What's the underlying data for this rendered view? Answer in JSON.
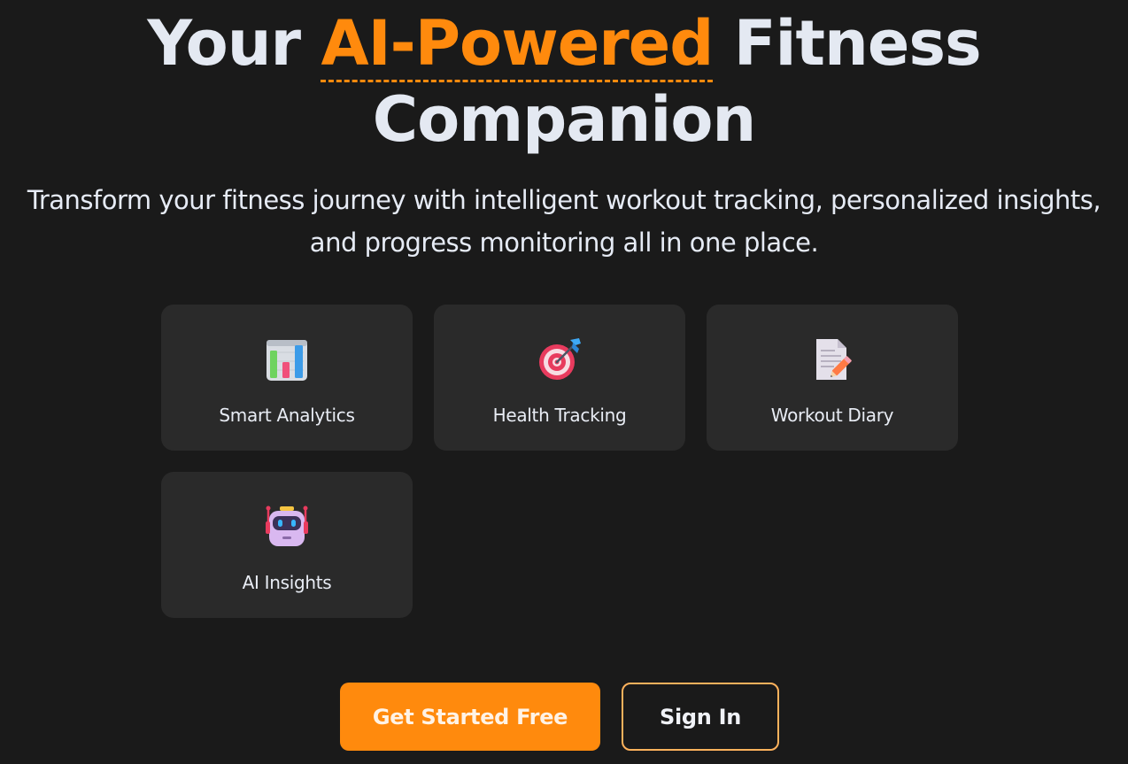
{
  "hero": {
    "title_prefix": "Your ",
    "title_accent": "AI-Powered",
    "title_suffix": " Fitness Companion",
    "subtitle": "Transform your fitness journey with intelligent workout tracking, personalized insights, and progress monitoring all in one place."
  },
  "features": [
    {
      "label": "Smart Analytics",
      "icon": "bar-chart-icon"
    },
    {
      "label": "Health Tracking",
      "icon": "target-icon"
    },
    {
      "label": "Workout Diary",
      "icon": "notepad-icon"
    },
    {
      "label": "AI Insights",
      "icon": "robot-icon"
    }
  ],
  "actions": {
    "primary_label": "Get Started Free",
    "secondary_label": "Sign In"
  },
  "colors": {
    "background": "#1a1a1a",
    "card": "#2a2a2a",
    "accent": "#ff8a0d",
    "text": "#e4e9f2"
  }
}
